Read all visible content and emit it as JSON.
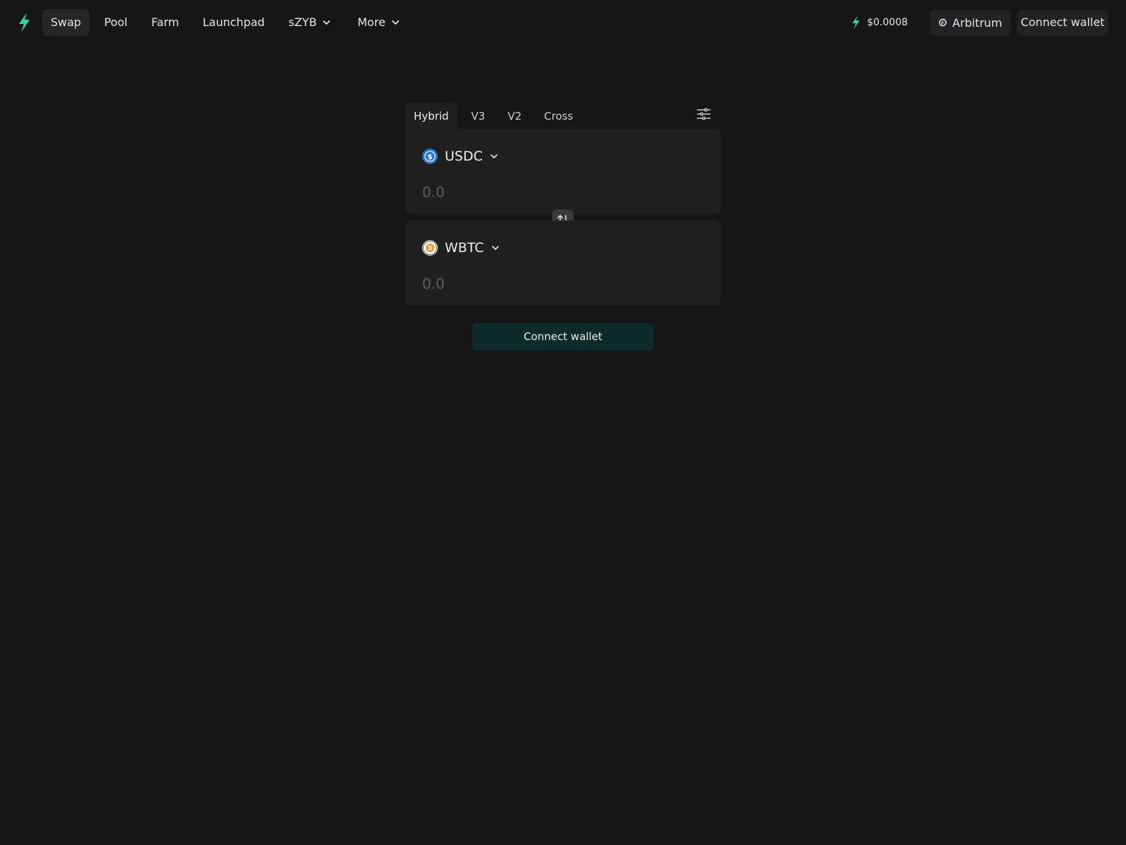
{
  "header": {
    "logo_icon": "lightning-bolt-icon",
    "nav": [
      {
        "label": "Swap",
        "active": true
      },
      {
        "label": "Pool"
      },
      {
        "label": "Farm"
      },
      {
        "label": "Launchpad"
      }
    ],
    "szyb_label": "sZYB",
    "more_label": "More",
    "token_price": "$0.0008",
    "network_label": "Arbitrum",
    "connect_label": "Connect wallet"
  },
  "swap": {
    "tabs": [
      "Hybrid",
      "V3",
      "V2",
      "Cross"
    ],
    "active_tab": "Hybrid",
    "from": {
      "symbol": "USDC",
      "icon": "usdc-icon",
      "placeholder": "0.0"
    },
    "to": {
      "symbol": "WBTC",
      "icon": "wbtc-icon",
      "placeholder": "0.0"
    },
    "connect_label": "Connect wallet"
  },
  "colors": {
    "background": "#161616",
    "card": "#1f1f1f",
    "accent": "#2dd4a8",
    "connect_button": "#0c2b29"
  }
}
